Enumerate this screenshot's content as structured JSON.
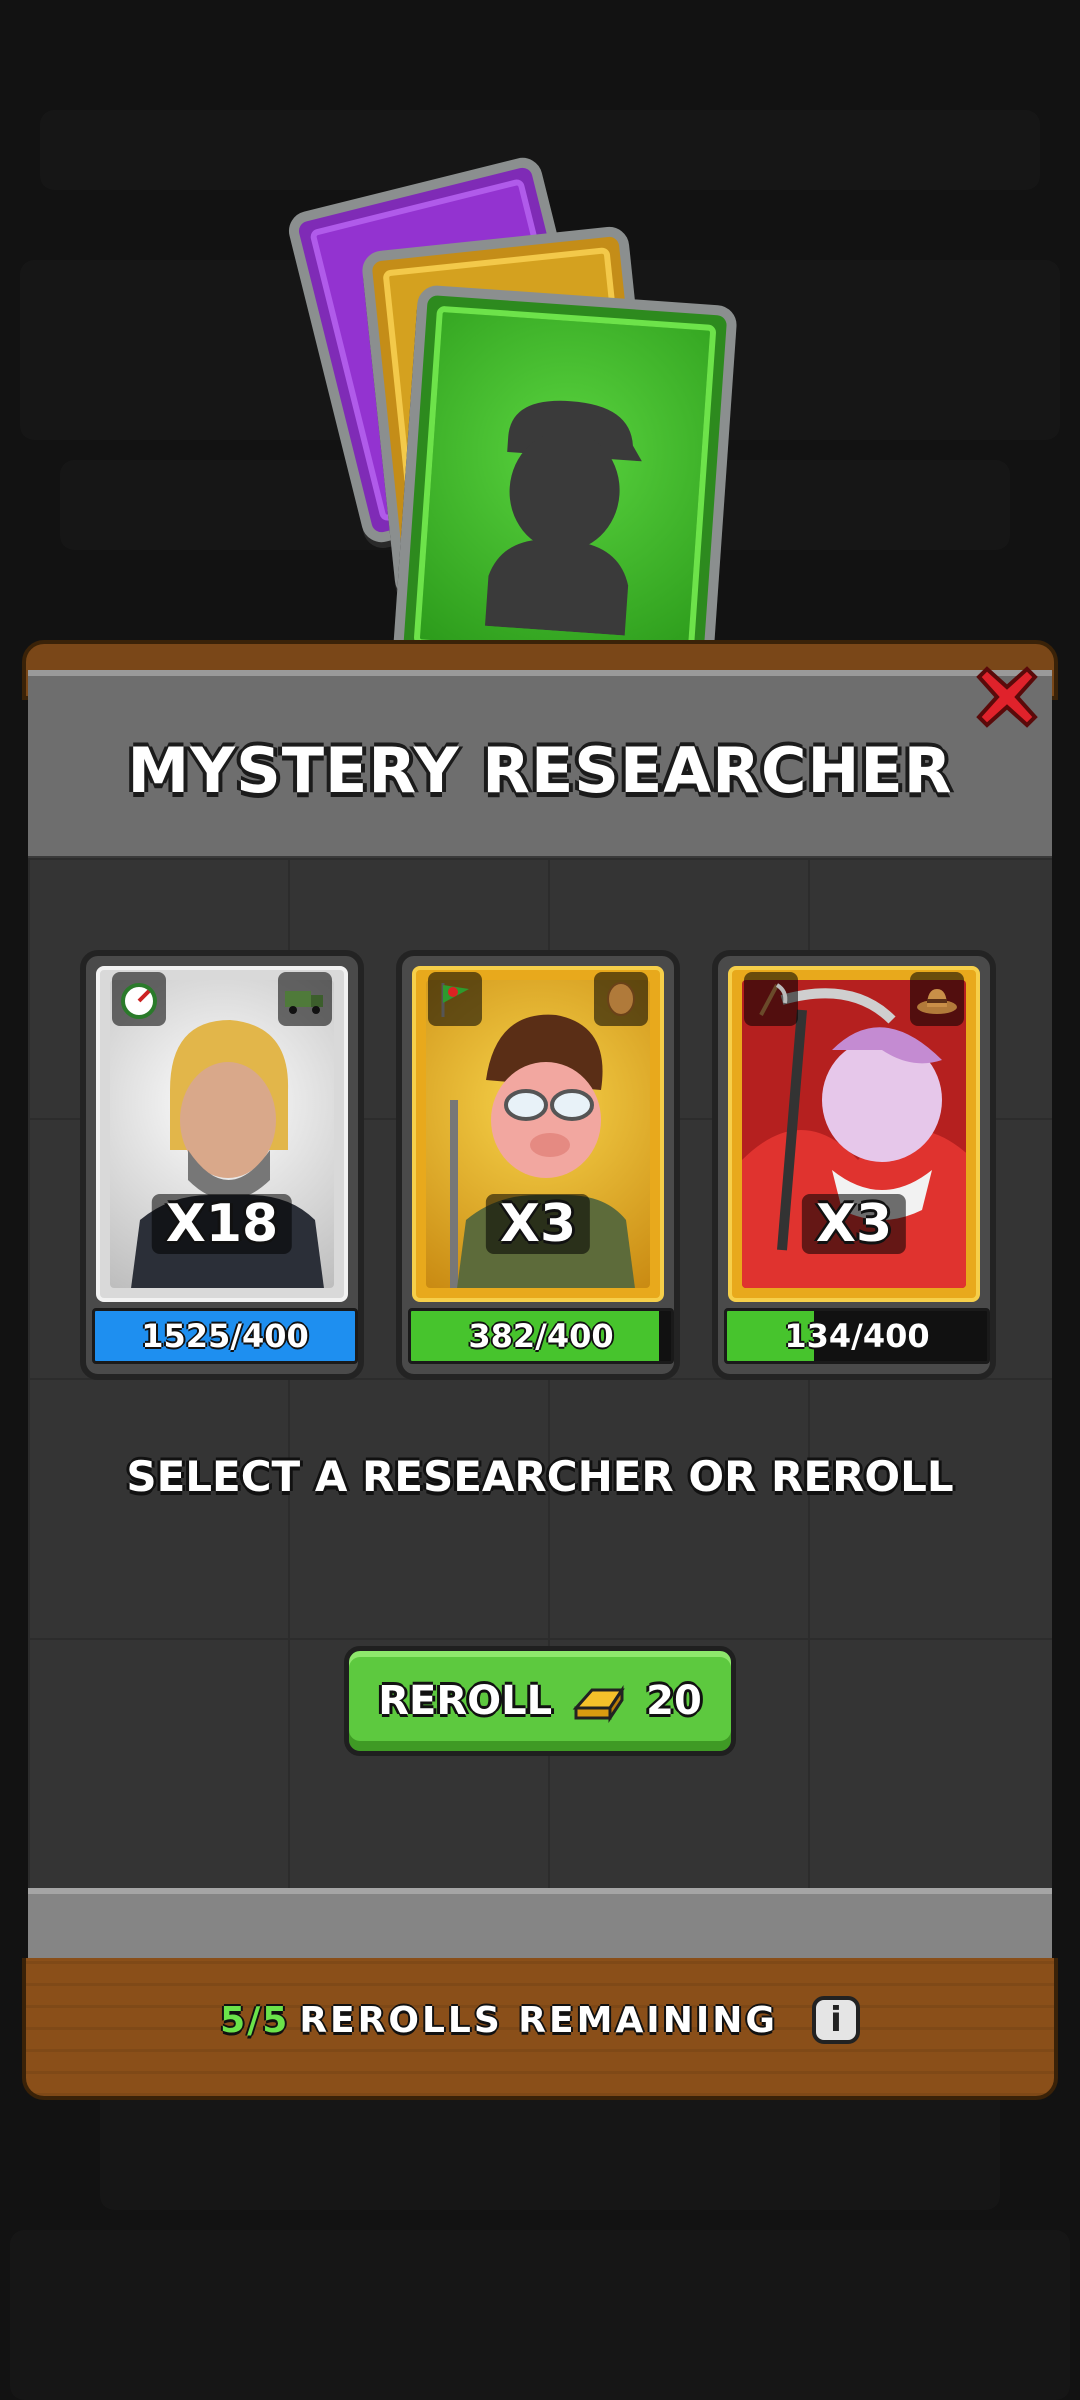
{
  "modal": {
    "title": "MYSTERY RESEARCHER",
    "prompt": "SELECT A RESEARCHER OR REROLL",
    "reroll": {
      "label": "REROLL",
      "cost": "20",
      "icon": "gold-bar-icon"
    },
    "rerolls": {
      "count": "5/5",
      "label": "REROLLS REMAINING"
    },
    "close_icon": "close-icon",
    "info_icon": "info-icon"
  },
  "researchers": [
    {
      "multiplier": "X18",
      "progress_text": "1525/400",
      "progress": 1.0,
      "rarity": "common",
      "bar_color": "#1e8ff0",
      "badges": [
        "speedometer-icon",
        "supply-truck-icon"
      ]
    },
    {
      "multiplier": "X3",
      "progress_text": "382/400",
      "progress": 0.955,
      "rarity": "rare",
      "bar_color": "#47c42d",
      "badges": [
        "flag-icon",
        "potato-icon"
      ]
    },
    {
      "multiplier": "X3",
      "progress_text": "134/400",
      "progress": 0.335,
      "rarity": "rare",
      "bar_color": "#47c42d",
      "badges": [
        "scythe-icon",
        "straw-hat-icon"
      ]
    }
  ],
  "colors": {
    "accent_green": "#6be34a",
    "close_red": "#e0222b",
    "common_frame": "#d9d9d9",
    "rare_frame": "#e8a91c"
  }
}
